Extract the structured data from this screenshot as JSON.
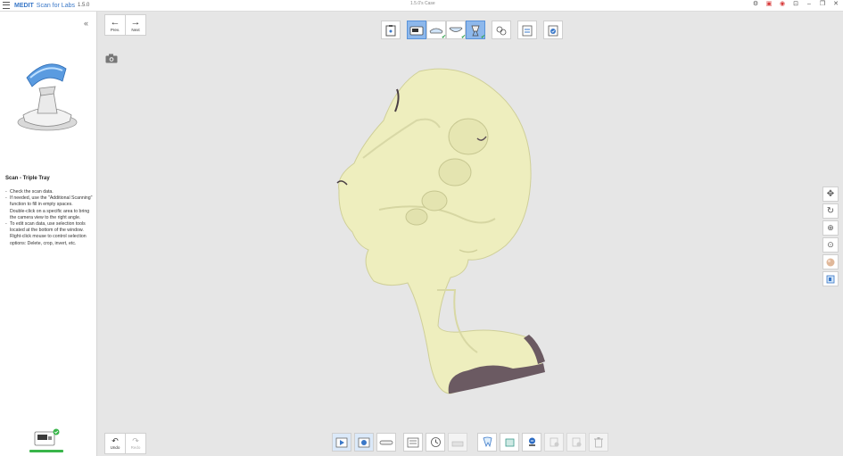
{
  "titlebar": {
    "brand": "MEDIT",
    "app_name": "Scan for Labs",
    "version": "1.5.0",
    "case_name": "1.5.0's Case"
  },
  "sidebar": {
    "step_title": "Scan - Triple Tray",
    "instructions": [
      "Check the scan data.",
      "If needed, use the \"Additional Scanning\" function to fill in empty spaces.",
      "Double-click on a specific area to bring the camera view to the right angle.",
      "To edit scan data, use selection tools located at the bottom of the window.",
      "Right-click mouse to control selection options: Delete, crop, invert, etc."
    ]
  },
  "nav": {
    "prev_label": "Prev.",
    "next_label": "Next"
  },
  "history": {
    "undo_label": "Undo",
    "redo_label": "Redo"
  },
  "colors": {
    "accent": "#3a78c8",
    "selected_tool": "#8db8ec",
    "scan_model": "#eeeebe",
    "progress": "#39b54a"
  }
}
